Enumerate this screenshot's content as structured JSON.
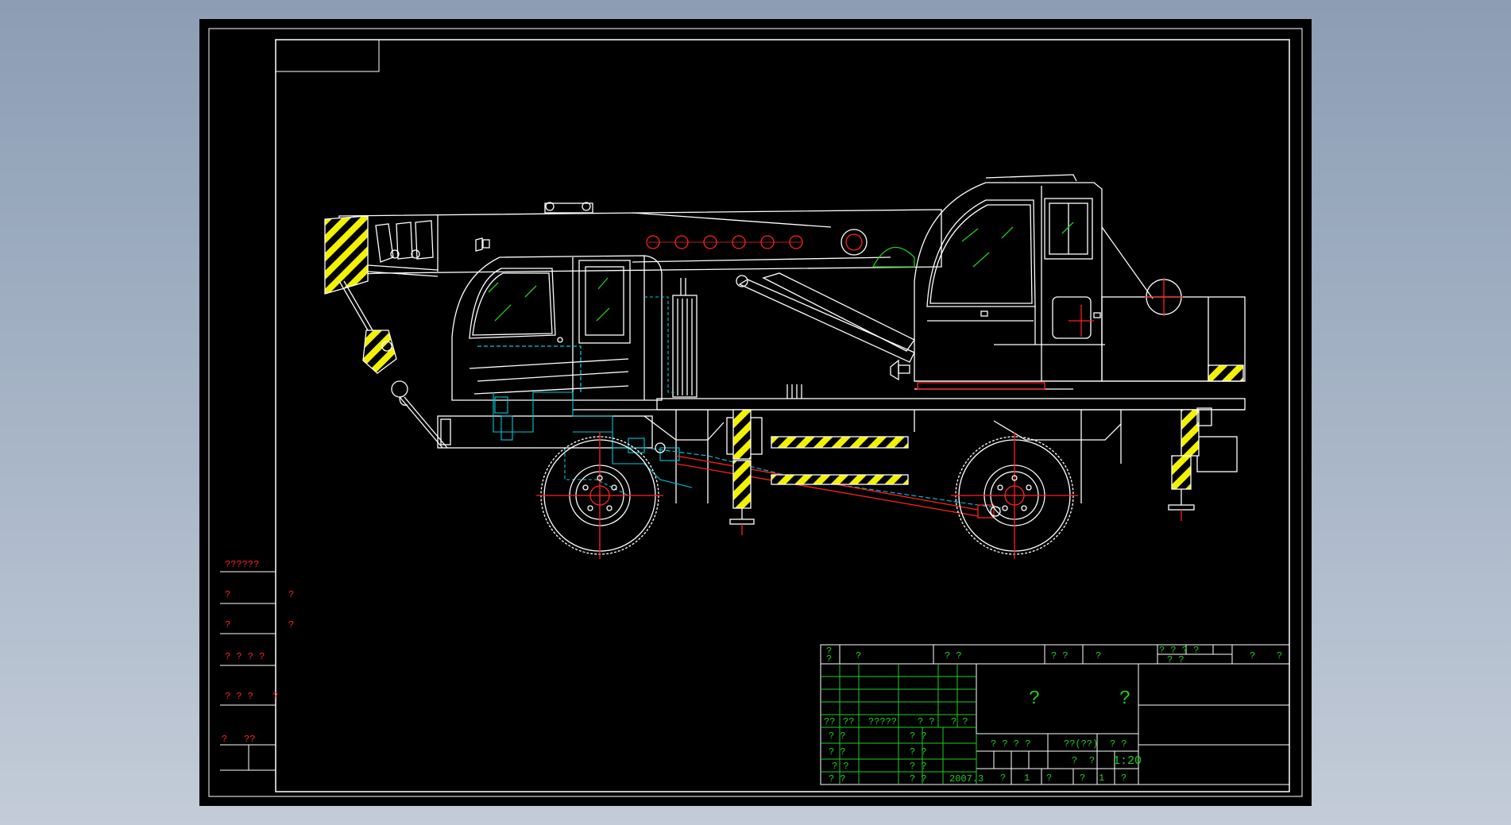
{
  "colors": {
    "background_top": "#8c9db4",
    "background_bottom": "#c3ccd8",
    "sheet": "#000000",
    "line_white": "#ffffff",
    "line_green": "#22cc22",
    "line_cyan": "#00c8d8",
    "line_red": "#ff2020",
    "hazard_yellow": "#f2f200",
    "hazard_black": "#000000"
  },
  "left_notes": [
    {
      "text": "??????"
    },
    {
      "text": "?",
      "value": "?"
    },
    {
      "text": "?",
      "value": "?"
    },
    {
      "text": "? ? ? ?"
    },
    {
      "text": "?  ?  ?",
      "value": "?"
    },
    {
      "text": "?",
      "value": "??"
    }
  ],
  "title_block": {
    "revision_row": [
      "?",
      "?",
      "? ?",
      "? ?",
      "?",
      "? ? ? ?",
      "? ?",
      "?",
      "?"
    ],
    "revision_sub": "?",
    "sign_header": [
      "??",
      "??",
      "?????",
      "? ?",
      "? ?"
    ],
    "sign_rows": [
      [
        "? ?",
        "? ?"
      ],
      [
        "? ?",
        "? ?"
      ],
      [
        "? ?",
        "? ?"
      ],
      [
        "? ?",
        "? ?"
      ]
    ],
    "drawing_name_left": "?",
    "drawing_name_right": "?",
    "stage_labels": [
      "? ? ? ?",
      "??(??)",
      "? ?"
    ],
    "scale_marks": [
      "?",
      "?"
    ],
    "scale": "1:20",
    "date": "2007.3",
    "sheet_info": [
      "?",
      "1",
      "?",
      "?",
      "1",
      "?"
    ]
  }
}
